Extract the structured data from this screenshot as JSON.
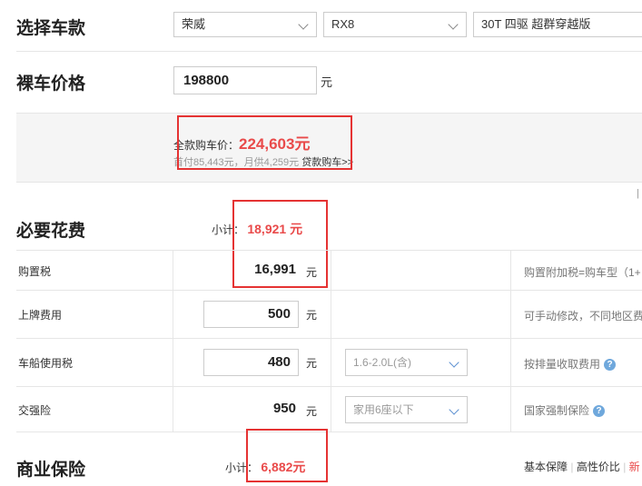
{
  "select_model": {
    "title": "选择车款",
    "brand": "荣威",
    "series": "RX8",
    "variant": "30T 四驱 超群穿越版"
  },
  "bare_price": {
    "title": "裸车价格",
    "value": "198800",
    "unit": "元"
  },
  "summary": {
    "total_label": "全款购车价：",
    "total_value": "224,603元",
    "loan_text": "首付85,443元，月供4,259元",
    "loan_link": "贷款购车>>"
  },
  "required": {
    "title": "必要花费",
    "subtotal_label": "小计：",
    "subtotal_value": "18,921 元",
    "rows": [
      {
        "label": "购置税",
        "value": "16,991",
        "unit": "元",
        "note": "购置附加税=购车型（1+"
      },
      {
        "label": "上牌费用",
        "value": "500",
        "unit": "元",
        "note": "可手动修改，不同地区费"
      },
      {
        "label": "车船使用税",
        "value": "480",
        "unit": "元",
        "option": "1.6-2.0L(含)",
        "note": "按排量收取费用"
      },
      {
        "label": "交强险",
        "value": "950",
        "unit": "元",
        "option": "家用6座以下",
        "note": "国家强制保险"
      }
    ]
  },
  "commercial": {
    "title": "商业保险",
    "subtotal_label": "小计：",
    "subtotal_value": "6,882元",
    "tab_basic": "基本保障",
    "tab_value": "高性价比",
    "tab_new": "新"
  },
  "colors": {
    "accent_red": "#e94a4a",
    "box_red": "#e53333",
    "help_blue": "#6fa8dc"
  }
}
